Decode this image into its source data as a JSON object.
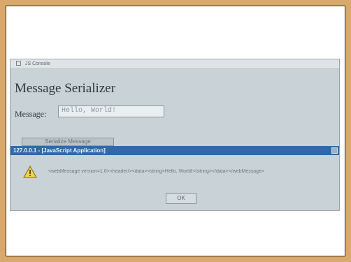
{
  "window": {
    "title": "JS Console",
    "heading": "Message Serializer",
    "message_label": "Message:",
    "message_value": "Hello, World!",
    "serialize_button": "Serialize Message"
  },
  "alert": {
    "title": "127.0.0.1 - [JavaScript Application]",
    "text": "<webMessage version=1.0><header/><data><string>Hello, World!</string></data></webMessage>",
    "ok_label": "OK"
  }
}
